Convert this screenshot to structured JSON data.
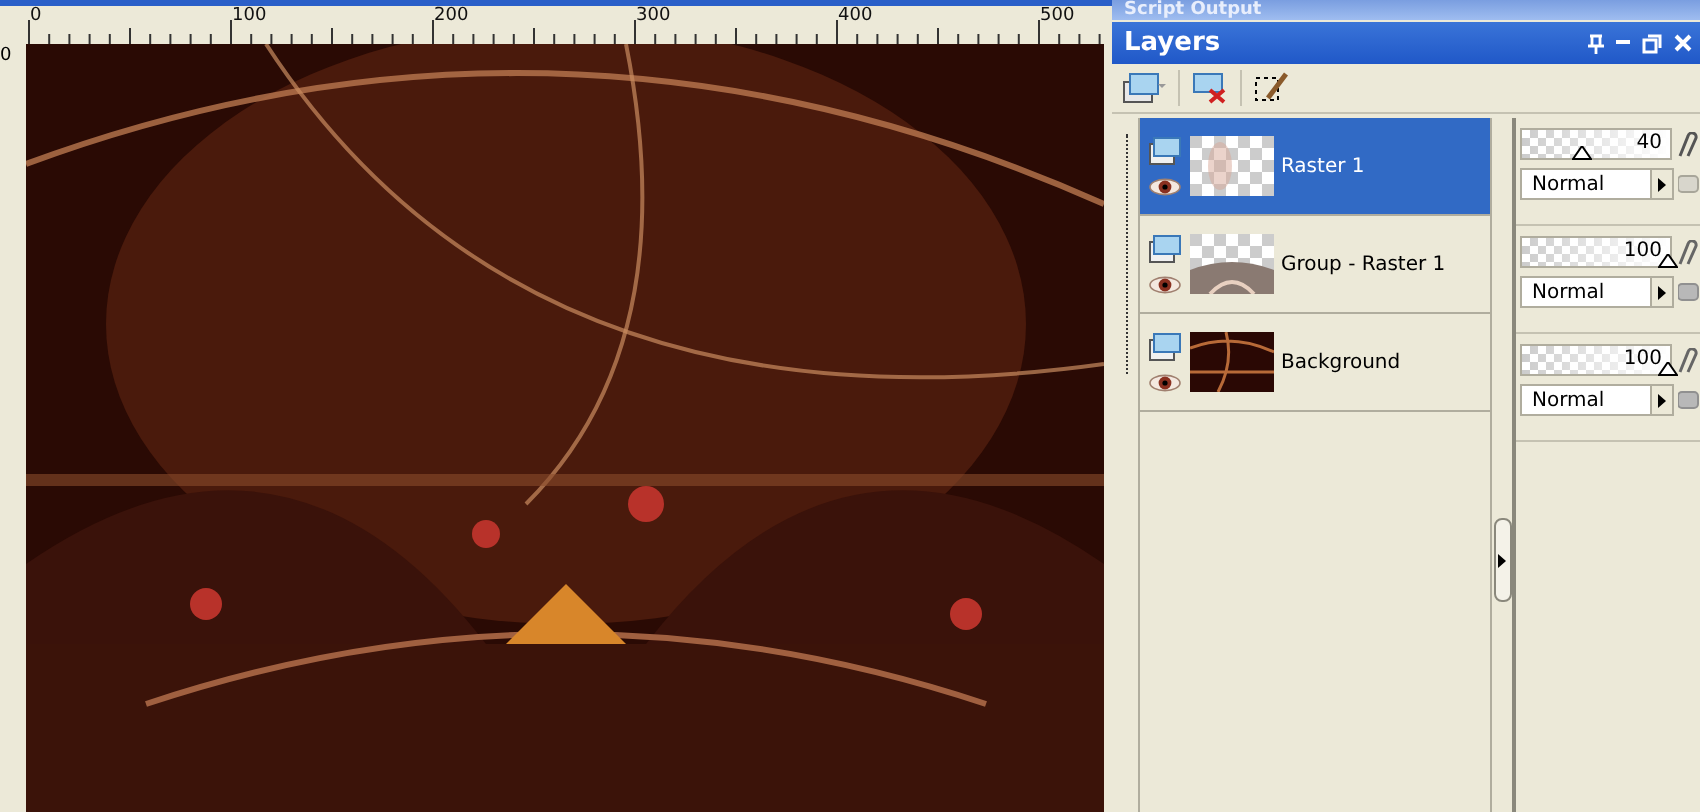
{
  "ruler": {
    "labels": [
      "0",
      "100",
      "200",
      "300",
      "400",
      "500"
    ],
    "vertical_labels": [
      "0"
    ]
  },
  "script_output": {
    "title": "Script Output"
  },
  "layers_panel": {
    "title": "Layers",
    "layers": [
      {
        "kind": "raster",
        "name": "Raster 1",
        "selected": true,
        "opacity": "40",
        "level": 0.4,
        "blend_mode": "Normal"
      },
      {
        "kind": "group",
        "name": "Group - Raster 1",
        "selected": false,
        "opacity": "100",
        "level": 1,
        "blend_mode": "Normal"
      },
      {
        "kind": "background",
        "name": "Background",
        "selected": false,
        "opacity": "100",
        "level": 1,
        "blend_mode": "Normal"
      }
    ]
  }
}
